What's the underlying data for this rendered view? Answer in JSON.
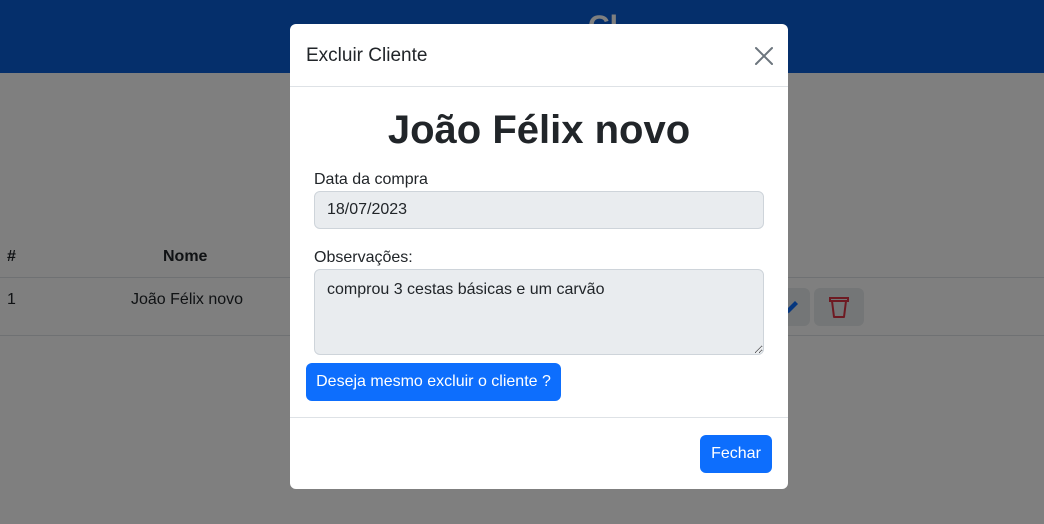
{
  "page": {
    "header_title": "Cl",
    "table": {
      "columns": [
        "#",
        "Nome"
      ],
      "rows": [
        {
          "index": "1",
          "name": "João Félix novo"
        }
      ]
    }
  },
  "modal": {
    "title": "Excluir Cliente",
    "client_name": "João Félix novo",
    "date_label": "Data da compra",
    "date_value": "18/07/2023",
    "notes_label": "Observações:",
    "notes_value": "comprou 3 cestas básicas e um carvão",
    "confirm_label": "Deseja mesmo excluir o cliente ?",
    "close_label": "Fechar",
    "close_icon": "close-icon"
  },
  "colors": {
    "header_blue": "#0b5ed7",
    "primary": "#0d6efd",
    "delete_red": "#dc3545",
    "edit_blue": "#0d6efd"
  }
}
